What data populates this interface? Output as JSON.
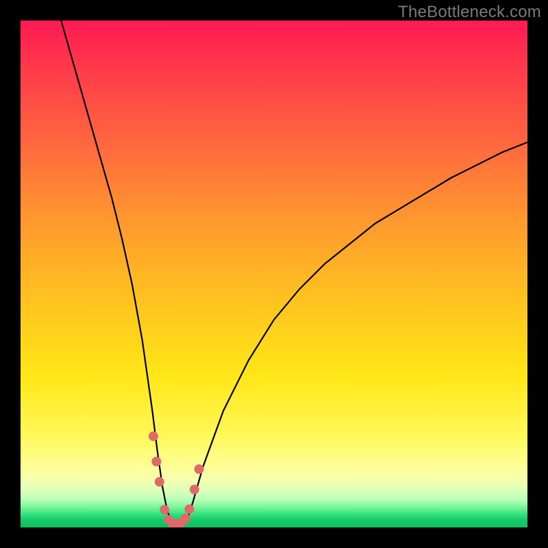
{
  "watermark": "TheBottleneck.com",
  "colors": {
    "marker": "#e06a6a",
    "curve": "#000000",
    "frame": "#000000"
  },
  "chart_data": {
    "type": "line",
    "title": "",
    "xlabel": "",
    "ylabel": "",
    "xlim": [
      0,
      100
    ],
    "ylim": [
      0,
      100
    ],
    "grid": false,
    "legend": false,
    "series": [
      {
        "name": "bottleneck-curve",
        "x": [
          8,
          10,
          12,
          14,
          16,
          18,
          20,
          22,
          24,
          26,
          27,
          28,
          29,
          30,
          31,
          32,
          33,
          34,
          36,
          40,
          45,
          50,
          55,
          60,
          65,
          70,
          75,
          80,
          85,
          90,
          95,
          100
        ],
        "y": [
          100,
          93,
          86,
          79,
          72,
          65,
          57,
          48,
          37,
          23,
          15,
          8,
          3,
          1,
          0.5,
          0.7,
          2,
          5,
          12,
          23,
          33,
          41,
          47,
          52,
          56,
          60,
          63,
          66,
          69,
          71.5,
          74,
          76
        ]
      }
    ],
    "markers": {
      "name": "highlight-points",
      "x": [
        26.2,
        26.8,
        27.4,
        28.4,
        29.2,
        30.0,
        30.8,
        31.6,
        32.5,
        33.3,
        34.3,
        35.2
      ],
      "y": [
        18,
        13,
        9,
        3.5,
        1.5,
        0.7,
        0.6,
        0.9,
        1.8,
        3.6,
        7.5,
        11.5
      ]
    }
  }
}
